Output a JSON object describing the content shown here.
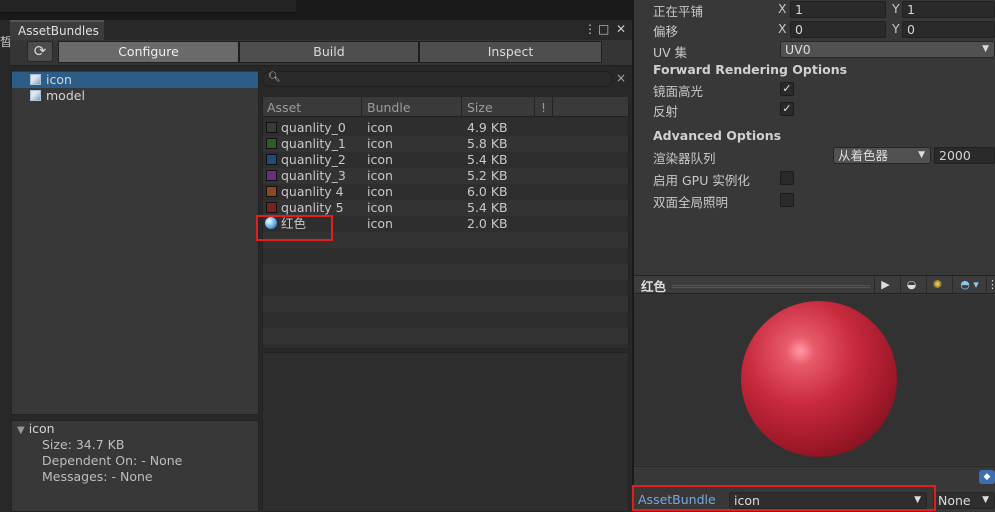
{
  "window": {
    "tab_title": "AssetBundles",
    "edge_fragment": "晳"
  },
  "toolbar": {
    "tabs": [
      "Configure",
      "Build",
      "Inspect"
    ],
    "active_tab": "Configure",
    "refresh_icon": "refresh-icon"
  },
  "tree": {
    "items": [
      {
        "label": "icon",
        "selected": true
      },
      {
        "label": "model",
        "selected": false
      }
    ]
  },
  "info": {
    "title": "icon",
    "size": "Size: 34.7 KB",
    "dependent": "Dependent On: - None",
    "messages": "Messages: - None"
  },
  "search": {
    "placeholder": "",
    "clear": "×"
  },
  "table": {
    "headers": [
      "Asset",
      "Bundle",
      "Size",
      "!"
    ],
    "rows": [
      {
        "name": "quanlity_0",
        "bundle": "icon",
        "size": "4.9 KB",
        "color": "#3a3a3a"
      },
      {
        "name": "quanlity_1",
        "bundle": "icon",
        "size": "5.8 KB",
        "color": "#2f5a2a"
      },
      {
        "name": "quanlity_2",
        "bundle": "icon",
        "size": "5.4 KB",
        "color": "#1e4d7a"
      },
      {
        "name": "quanlity_3",
        "bundle": "icon",
        "size": "5.2 KB",
        "color": "#6a2f7a"
      },
      {
        "name": "quanlity 4",
        "bundle": "icon",
        "size": "6.0 KB",
        "color": "#8a4a1e"
      },
      {
        "name": "quanlity 5",
        "bundle": "icon",
        "size": "5.4 KB",
        "color": "#7a2222"
      },
      {
        "name": "红色",
        "bundle": "icon",
        "size": "2.0 KB",
        "color": "material"
      }
    ]
  },
  "inspector": {
    "tiling_label": "正在平铺",
    "tiling_x": "1",
    "tiling_y": "1",
    "offset_label": "偏移",
    "offset_x": "0",
    "offset_y": "0",
    "x": "X",
    "y": "Y",
    "uv_label": "UV 集",
    "uv_value": "UV0",
    "forward_title": "Forward Rendering Options",
    "specular_label": "镜面高光",
    "reflection_label": "反射",
    "advanced_title": "Advanced Options",
    "render_queue_label": "渲染器队列",
    "render_queue_source": "从着色器",
    "render_queue_value": "2000",
    "gpu_instancing_label": "启用 GPU 实例化",
    "double_gi_label": "双面全局照明",
    "check": "✓"
  },
  "preview": {
    "title": "红色",
    "play": "▶"
  },
  "assetbundle": {
    "label": "AssetBundle",
    "value": "icon",
    "variant": "None"
  },
  "colors": {
    "accent_blue": "#2c5d87",
    "highlight_red": "#e02020",
    "sphere_red": "#c8293d"
  }
}
